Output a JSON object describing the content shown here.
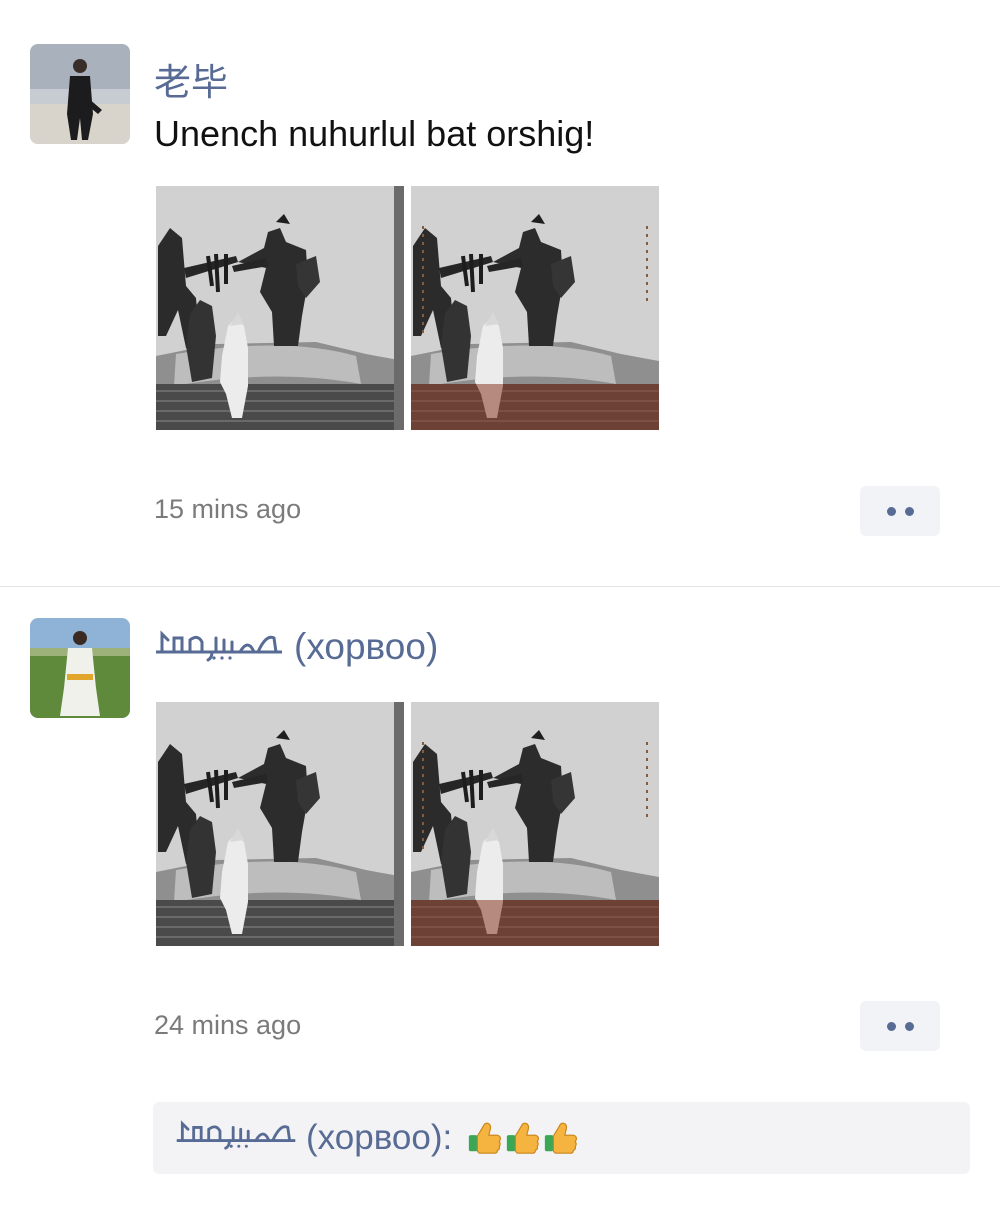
{
  "posts": [
    {
      "author": "老毕",
      "text": "Unench nuhurlul bat orshig!",
      "time": "15 mins ago"
    },
    {
      "author_script": "ᠬᠣᠷᠪᠣᠭ᠎ᠠ",
      "author": "(хорвоо)",
      "time": "24 mins ago",
      "comment": {
        "author_script": "ᠬᠣᠷᠪᠣᠭ᠎ᠠ",
        "author": "(хорвоо):",
        "text": "👍👍👍"
      }
    }
  ],
  "colors": {
    "link": "#576b95",
    "time": "#7b7b7b",
    "button_bg": "#f2f3f7",
    "comment_bg": "#f3f3f5",
    "divider": "#e3e3e3"
  },
  "icons": [
    "more-dots-icon",
    "thumbs-up-icon"
  ]
}
